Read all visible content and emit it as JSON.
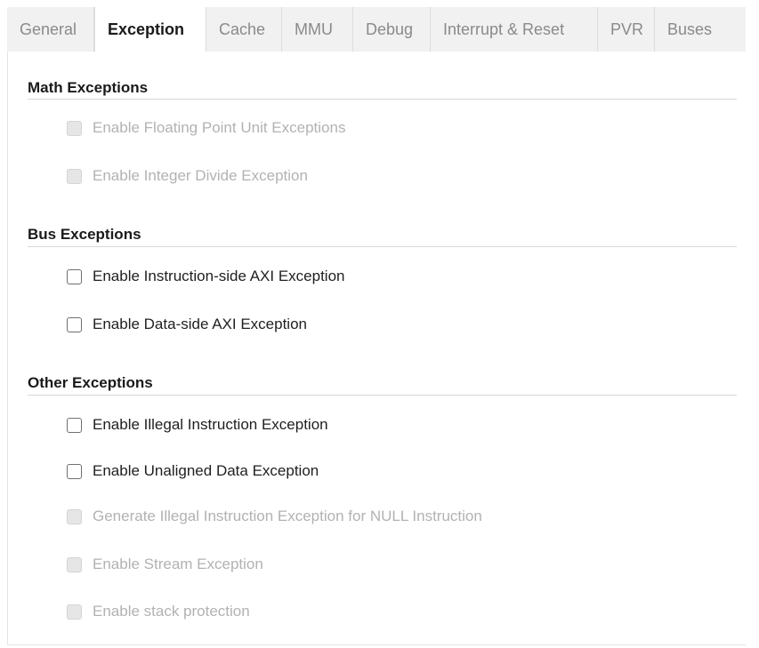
{
  "tabs": [
    {
      "label": "General"
    },
    {
      "label": "Exception"
    },
    {
      "label": "Cache"
    },
    {
      "label": "MMU"
    },
    {
      "label": "Debug"
    },
    {
      "label": "Interrupt & Reset"
    },
    {
      "label": "PVR"
    },
    {
      "label": "Buses"
    }
  ],
  "active_tab": "Exception",
  "sections": {
    "math": {
      "title": "Math Exceptions",
      "options": [
        {
          "label": "Enable Floating Point Unit Exceptions",
          "checked": false,
          "enabled": false
        },
        {
          "label": "Enable Integer Divide Exception",
          "checked": false,
          "enabled": false
        }
      ]
    },
    "bus": {
      "title": "Bus Exceptions",
      "options": [
        {
          "label": "Enable Instruction-side AXI Exception",
          "checked": false,
          "enabled": true
        },
        {
          "label": "Enable Data-side AXI Exception",
          "checked": false,
          "enabled": true
        }
      ]
    },
    "other": {
      "title": "Other Exceptions",
      "options": [
        {
          "label": "Enable Illegal Instruction Exception",
          "checked": false,
          "enabled": true
        },
        {
          "label": "Enable Unaligned Data Exception",
          "checked": false,
          "enabled": true
        },
        {
          "label": "Generate Illegal Instruction Exception for NULL Instruction",
          "checked": false,
          "enabled": false
        },
        {
          "label": "Enable Stream Exception",
          "checked": false,
          "enabled": false
        },
        {
          "label": "Enable stack protection",
          "checked": false,
          "enabled": false
        }
      ]
    }
  },
  "colors": {
    "tabbar_bg": "#f1f1f1",
    "active_tab_text": "#1a1a1a",
    "inactive_tab_text": "#8a8a8a",
    "disabled_text": "#b2b2b2",
    "enabled_text": "#1f1f1f"
  }
}
